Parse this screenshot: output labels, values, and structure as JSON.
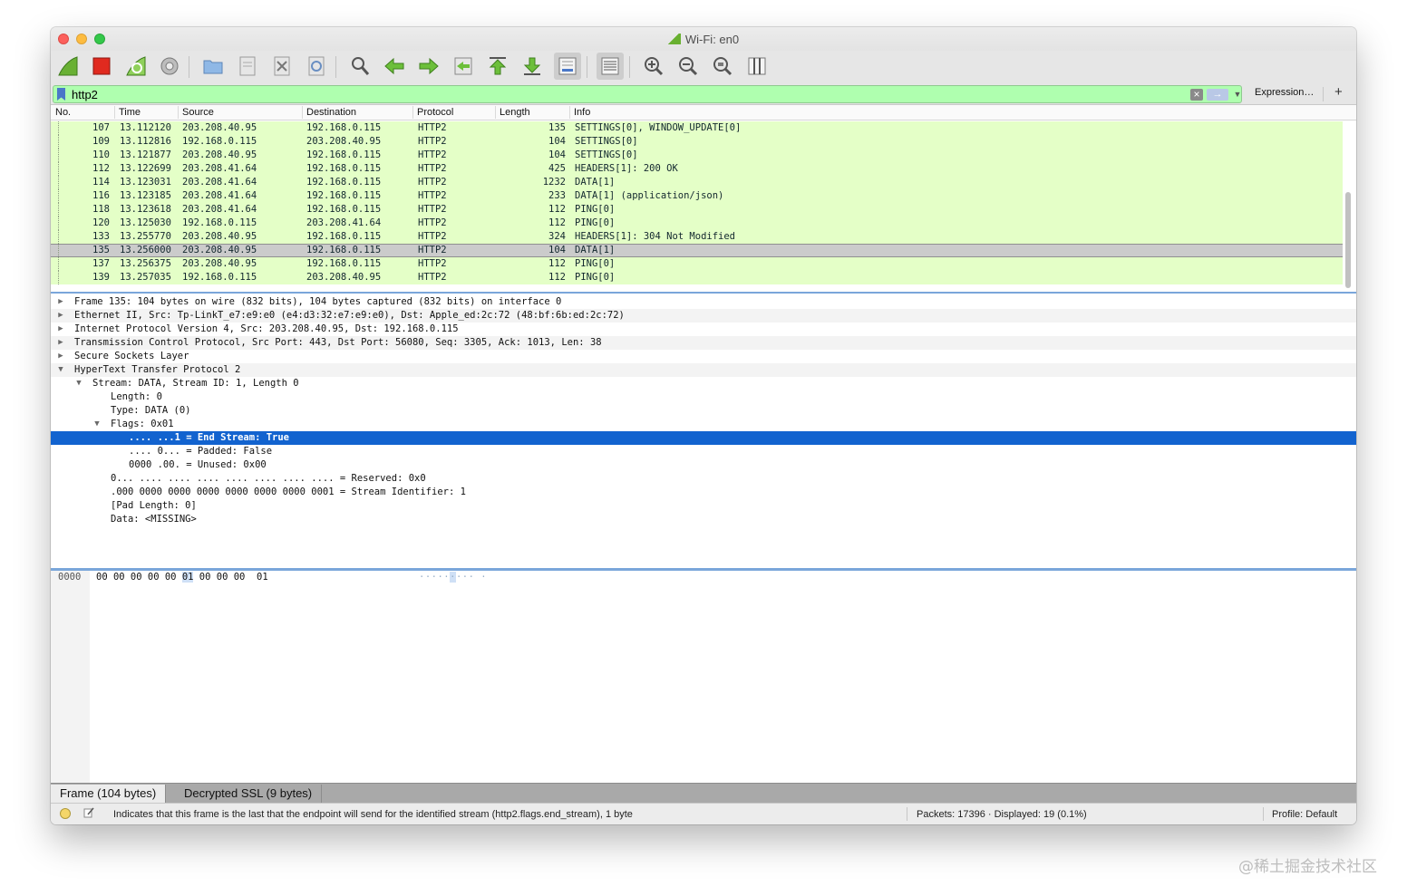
{
  "window": {
    "title": "Wi-Fi: en0"
  },
  "filter": {
    "value": "http2",
    "expression_label": "Expression…",
    "add_label": "+"
  },
  "packet_list": {
    "columns": [
      "No.",
      "Time",
      "Source",
      "Destination",
      "Protocol",
      "Length",
      "Info"
    ],
    "rows": [
      {
        "no": "107",
        "time": "13.112120",
        "src": "203.208.40.95",
        "dst": "192.168.0.115",
        "proto": "HTTP2",
        "len": "135",
        "info": "SETTINGS[0], WINDOW_UPDATE[0]"
      },
      {
        "no": "109",
        "time": "13.112816",
        "src": "192.168.0.115",
        "dst": "203.208.40.95",
        "proto": "HTTP2",
        "len": "104",
        "info": "SETTINGS[0]"
      },
      {
        "no": "110",
        "time": "13.121877",
        "src": "203.208.40.95",
        "dst": "192.168.0.115",
        "proto": "HTTP2",
        "len": "104",
        "info": "SETTINGS[0]"
      },
      {
        "no": "112",
        "time": "13.122699",
        "src": "203.208.41.64",
        "dst": "192.168.0.115",
        "proto": "HTTP2",
        "len": "425",
        "info": "HEADERS[1]: 200 OK"
      },
      {
        "no": "114",
        "time": "13.123031",
        "src": "203.208.41.64",
        "dst": "192.168.0.115",
        "proto": "HTTP2",
        "len": "1232",
        "info": "DATA[1]"
      },
      {
        "no": "116",
        "time": "13.123185",
        "src": "203.208.41.64",
        "dst": "192.168.0.115",
        "proto": "HTTP2",
        "len": "233",
        "info": "DATA[1] (application/json)"
      },
      {
        "no": "118",
        "time": "13.123618",
        "src": "203.208.41.64",
        "dst": "192.168.0.115",
        "proto": "HTTP2",
        "len": "112",
        "info": "PING[0]"
      },
      {
        "no": "120",
        "time": "13.125030",
        "src": "192.168.0.115",
        "dst": "203.208.41.64",
        "proto": "HTTP2",
        "len": "112",
        "info": "PING[0]"
      },
      {
        "no": "133",
        "time": "13.255770",
        "src": "203.208.40.95",
        "dst": "192.168.0.115",
        "proto": "HTTP2",
        "len": "324",
        "info": "HEADERS[1]: 304 Not Modified"
      },
      {
        "no": "135",
        "time": "13.256000",
        "src": "203.208.40.95",
        "dst": "192.168.0.115",
        "proto": "HTTP2",
        "len": "104",
        "info": "DATA[1]"
      },
      {
        "no": "137",
        "time": "13.256375",
        "src": "203.208.40.95",
        "dst": "192.168.0.115",
        "proto": "HTTP2",
        "len": "112",
        "info": "PING[0]"
      },
      {
        "no": "139",
        "time": "13.257035",
        "src": "192.168.0.115",
        "dst": "203.208.40.95",
        "proto": "HTTP2",
        "len": "112",
        "info": "PING[0]"
      }
    ]
  },
  "details": [
    "Frame 135: 104 bytes on wire (832 bits), 104 bytes captured (832 bits) on interface 0",
    "Ethernet II, Src: Tp-LinkT_e7:e9:e0 (e4:d3:32:e7:e9:e0), Dst: Apple_ed:2c:72 (48:bf:6b:ed:2c:72)",
    "Internet Protocol Version 4, Src: 203.208.40.95, Dst: 192.168.0.115",
    "Transmission Control Protocol, Src Port: 443, Dst Port: 56080, Seq: 3305, Ack: 1013, Len: 38",
    "Secure Sockets Layer",
    "HyperText Transfer Protocol 2",
    "Stream: DATA, Stream ID: 1, Length 0",
    "Length: 0",
    "Type: DATA (0)",
    "Flags: 0x01",
    ".... ...1 = End Stream: True",
    ".... 0... = Padded: False",
    "0000 .00. = Unused: 0x00",
    "0... .... .... .... .... .... .... .... = Reserved: 0x0",
    ".000 0000 0000 0000 0000 0000 0000 0001 = Stream Identifier: 1",
    "[Pad Length: 0]",
    "Data: <MISSING>"
  ],
  "bytes": {
    "offset": "0000",
    "hex_before": "00 00 00 00 00 ",
    "hex_selected": "01",
    "hex_after": " 00 00 00  01",
    "ascii": "·····",
    "ascii_selected": "·",
    "ascii_after": "··· ·"
  },
  "bottom_tabs": [
    "Frame (104 bytes)",
    "Decrypted SSL (9 bytes)"
  ],
  "status": {
    "message": "Indicates that this frame is the last that the endpoint will send for the identified stream (http2.flags.end_stream), 1 byte",
    "packets": "Packets: 17396 · Displayed: 19 (0.1%)",
    "profile": "Profile: Default"
  },
  "watermark": "@稀土掘金技术社区",
  "colors": {
    "row_bg": "#e4ffc7",
    "filter_bg": "#afffaf",
    "highlight": "#1263cf",
    "selected_row": "#cbcbcb"
  }
}
